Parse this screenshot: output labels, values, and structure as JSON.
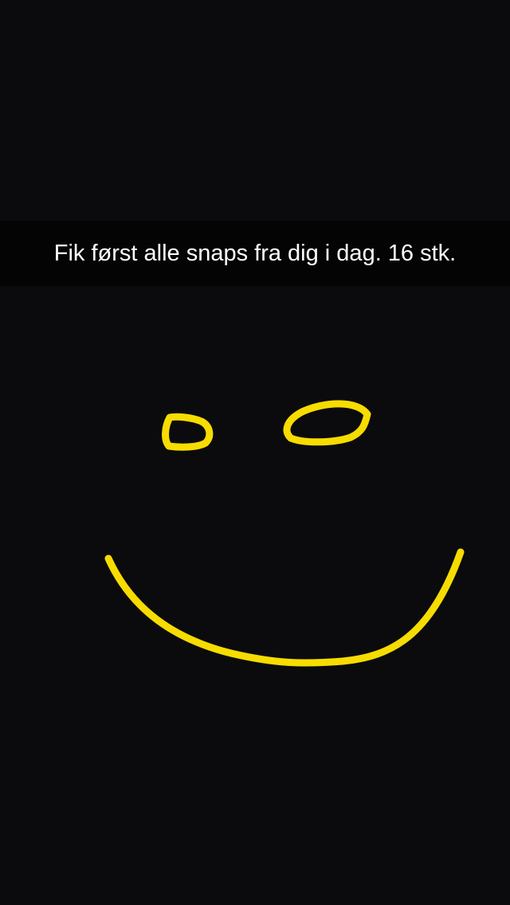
{
  "snap": {
    "caption": "Fik først alle snaps fra dig i dag. 16 stk."
  },
  "drawing": {
    "content": "smiley-face",
    "stroke_color": "#f6dc00",
    "background_color": "#0b0b0d"
  }
}
